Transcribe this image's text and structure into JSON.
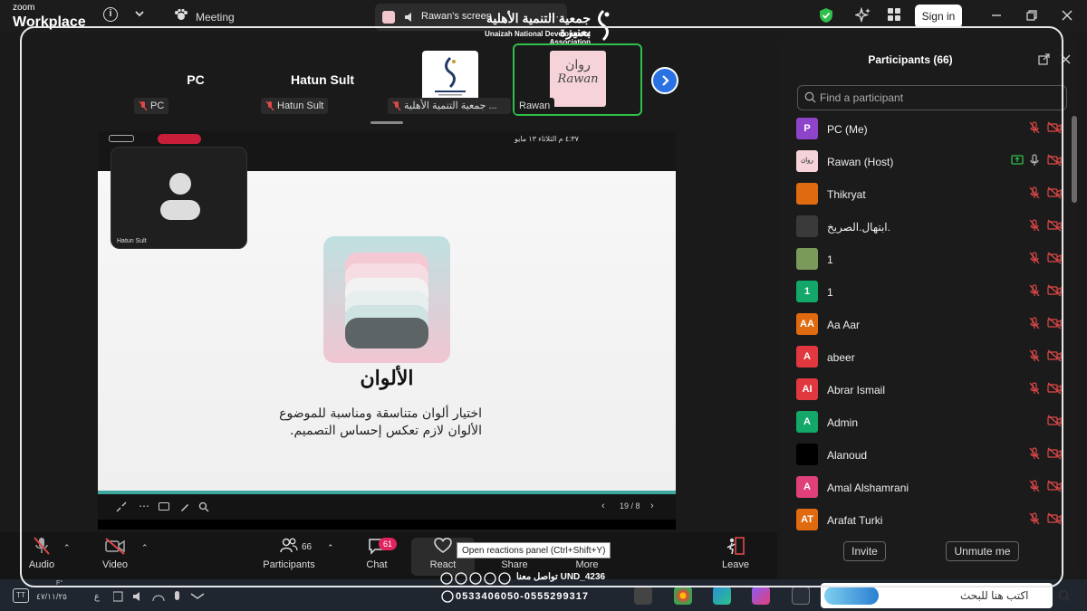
{
  "app": {
    "logo_line1": "zoom",
    "logo_line2": "Workplace",
    "meeting_label": "Meeting",
    "screen_label": "Rawan's screen",
    "sign_in": "Sign in"
  },
  "organization": {
    "name_ar": "جمعية التنمية الأهلية بعنيزة",
    "name_en": "Unaizah National Development Association"
  },
  "gallery": {
    "tiles": [
      {
        "display": "PC",
        "tag": "PC"
      },
      {
        "display": "Hatun Sult",
        "tag": "Hatun Sult"
      },
      {
        "display": "",
        "tag": "جمعية التنمية الأهلية ..."
      },
      {
        "display": "روان Rawan",
        "tag": "Rawan"
      }
    ],
    "rawan_ar": "روان",
    "rawan_en": "Rawan"
  },
  "shared_screen": {
    "status_time": "٤:٣٧ م  الثلاثاء ١٣ مايو",
    "slide_title": "الألوان",
    "slide_line1": "اختيار ألوان متناسقة ومناسبة للموضوع",
    "slide_line2": "الألوان لازم تعكس إحساس التصميم.",
    "page_indicator": "19 / 8",
    "pip_name": "Hatun Sult"
  },
  "participants_panel": {
    "title": "Participants (66)",
    "search_placeholder": "Find a participant",
    "invite": "Invite",
    "unmute_me": "Unmute me",
    "people": [
      {
        "name": "PC (Me)",
        "initials": "P",
        "color": "#8e44c9"
      },
      {
        "name": "Rawan (Host)",
        "initials": "روان",
        "color": "#f5d3d8"
      },
      {
        "name": " Thikryat",
        "initials": "",
        "color": "#e06a10"
      },
      {
        "name": "ابتهال.الصريخ.",
        "initials": "",
        "color": "#3a3a3a"
      },
      {
        "name": "1",
        "initials": "",
        "color": "#7a9a5a"
      },
      {
        "name": "1",
        "initials": "1",
        "color": "#13a86a"
      },
      {
        "name": "Aa Aar",
        "initials": "AA",
        "color": "#e06a10"
      },
      {
        "name": "abeer",
        "initials": "A",
        "color": "#e0383e"
      },
      {
        "name": "Abrar Ismail",
        "initials": "AI",
        "color": "#e0383e"
      },
      {
        "name": "Admin",
        "initials": "A",
        "color": "#13a86a"
      },
      {
        "name": "Alanoud",
        "initials": "",
        "color": "#000000"
      },
      {
        "name": "Amal Alshamrani",
        "initials": "A",
        "color": "#e0407a"
      },
      {
        "name": "Arafat Turki",
        "initials": "AT",
        "color": "#e06a10"
      }
    ]
  },
  "toolbar": {
    "audio": "Audio",
    "video": "Video",
    "participants": "Participants",
    "participants_count": "66",
    "chat": "Chat",
    "chat_badge": "61",
    "react": "React",
    "share": "Share",
    "more": "More",
    "leave": "Leave",
    "tooltip": "Open reactions panel (Ctrl+Shift+Y)"
  },
  "overlay": {
    "contact_line": "تواصل معنا  UND_4236",
    "phones": "0533406050-0555299317"
  },
  "taskbar": {
    "search_text": "اكتب هنا للبحث",
    "date": "٤٧/١١/٢٥",
    "lang": "ع",
    "temp": "F°‎"
  }
}
